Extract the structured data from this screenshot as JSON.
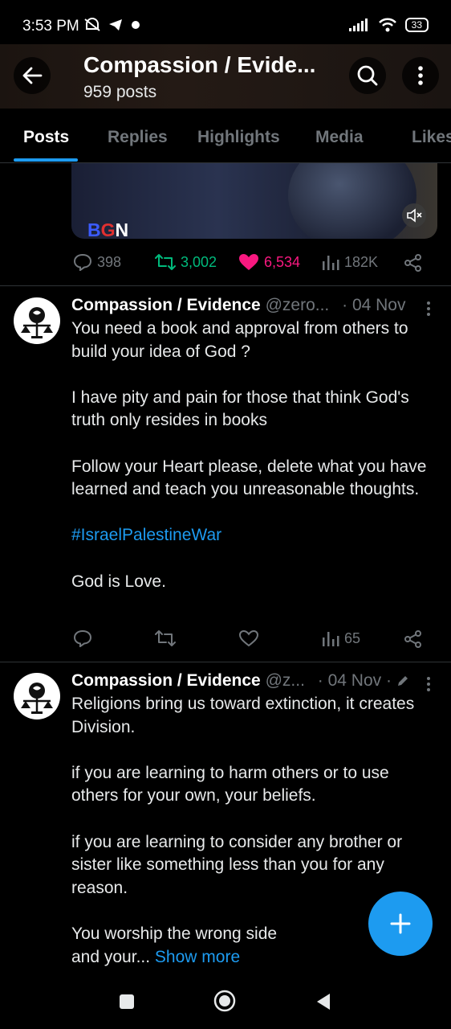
{
  "status_bar": {
    "time": "3:53 PM",
    "battery": "33"
  },
  "header": {
    "title": "Compassion / Evide...",
    "post_count": "959 posts"
  },
  "tabs": [
    {
      "label": "Posts",
      "active": true
    },
    {
      "label": "Replies"
    },
    {
      "label": "Highlights"
    },
    {
      "label": "Media"
    },
    {
      "label": "Likes"
    }
  ],
  "media": {
    "brand_letters": [
      "B",
      "G",
      "N"
    ],
    "brand_colors": [
      "#3b5bff",
      "#e03030",
      "#ffffff"
    ]
  },
  "first_post_actions": {
    "replies": "398",
    "reposts": "3,002",
    "likes": "6,534",
    "views": "182K"
  },
  "tweets": [
    {
      "name": "Compassion / Evidence",
      "handle": "@zero...",
      "date": "· 04 Nov",
      "paragraphs": [
        "You need a book and approval from others to build your idea of God ?",
        "I have pity and pain for those that think God's truth only resides in books",
        "Follow your Heart please, delete what you have learned and teach you unreasonable thoughts."
      ],
      "hashtag": "#IsraelPalestineWar",
      "closing": "God is Love.",
      "views": "65"
    },
    {
      "name": "Compassion / Evidence",
      "handle": "@z...",
      "date": "· 04 Nov ·",
      "paragraphs": [
        "Religions bring us toward extinction, it creates Division.",
        "if you are learning to harm others or to use others for your own, your beliefs.",
        "if you are learning to consider any brother or sister like something less than you for any reason."
      ],
      "closing_line1": "You worship the wrong side",
      "closing_line2": "and your...",
      "show_more": "Show more"
    }
  ],
  "colors": {
    "accent": "#1d9bf0",
    "repost": "#00ba7c",
    "like": "#f91880",
    "muted": "#71767b"
  }
}
